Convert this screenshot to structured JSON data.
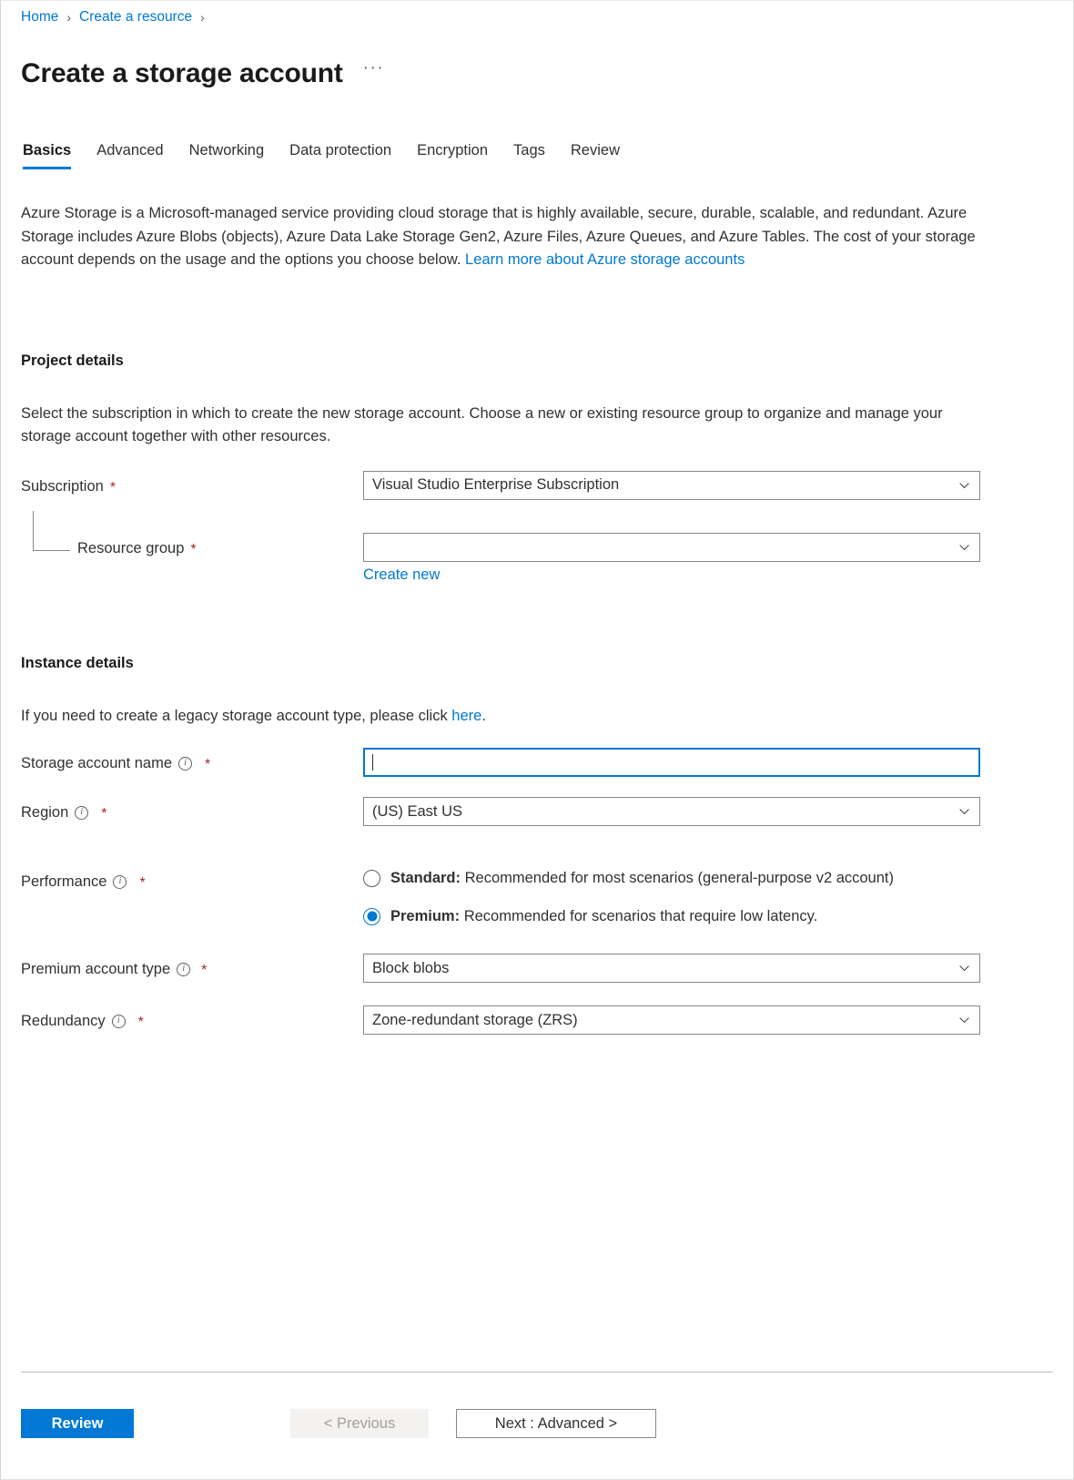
{
  "breadcrumb": {
    "items": [
      {
        "label": "Home"
      },
      {
        "label": "Create a resource"
      }
    ],
    "separator": "›"
  },
  "header": {
    "title": "Create a storage account",
    "more_menu": "···"
  },
  "tabs": [
    {
      "label": "Basics",
      "active": true
    },
    {
      "label": "Advanced",
      "active": false
    },
    {
      "label": "Networking",
      "active": false
    },
    {
      "label": "Data protection",
      "active": false
    },
    {
      "label": "Encryption",
      "active": false
    },
    {
      "label": "Tags",
      "active": false
    },
    {
      "label": "Review",
      "active": false
    }
  ],
  "intro": {
    "text": "Azure Storage is a Microsoft-managed service providing cloud storage that is highly available, secure, durable, scalable, and redundant. Azure Storage includes Azure Blobs (objects), Azure Data Lake Storage Gen2, Azure Files, Azure Queues, and Azure Tables. The cost of your storage account depends on the usage and the options you choose below. ",
    "link_text": "Learn more about Azure storage accounts"
  },
  "project_details": {
    "title": "Project details",
    "description": "Select the subscription in which to create the new storage account. Choose a new or existing resource group to organize and manage your storage account together with other resources.",
    "subscription": {
      "label": "Subscription",
      "required": "*",
      "value": "Visual Studio Enterprise Subscription"
    },
    "resource_group": {
      "label": "Resource group",
      "required": "*",
      "value": "",
      "create_new_label": "Create new"
    }
  },
  "instance_details": {
    "title": "Instance details",
    "legacy_note_prefix": "If you need to create a legacy storage account type, please click ",
    "legacy_note_link": "here",
    "legacy_note_suffix": ".",
    "storage_account_name": {
      "label": "Storage account name",
      "required": "*",
      "value": "",
      "placeholder": "",
      "focused": true
    },
    "region": {
      "label": "Region",
      "required": "*",
      "value": "(US) East US"
    },
    "performance": {
      "label": "Performance",
      "required": "*",
      "options": [
        {
          "key": "standard",
          "bold": "Standard:",
          "text": " Recommended for most scenarios (general-purpose v2 account)",
          "selected": false
        },
        {
          "key": "premium",
          "bold": "Premium:",
          "text": " Recommended for scenarios that require low latency.",
          "selected": true
        }
      ]
    },
    "premium_account_type": {
      "label": "Premium account type",
      "required": "*",
      "value": "Block blobs"
    },
    "redundancy": {
      "label": "Redundancy",
      "required": "*",
      "value": "Zone-redundant storage (ZRS)"
    }
  },
  "footer": {
    "review_label": "Review",
    "previous_label": "< Previous",
    "next_label": "Next : Advanced >"
  },
  "colors": {
    "accent": "#0078d4",
    "required": "#a4262c",
    "text": "#323130",
    "border": "#8a8886"
  },
  "icons": {
    "info": "ⓘ",
    "chevron_down": "chevron-down-icon"
  }
}
